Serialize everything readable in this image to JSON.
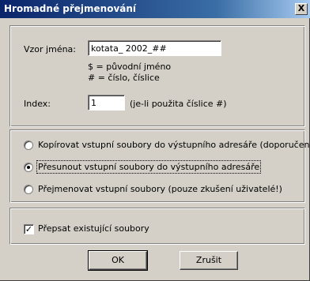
{
  "window": {
    "title": "Hromadné přejmenování",
    "close_glyph": "X"
  },
  "pattern": {
    "label": "Vzor jména:",
    "value": "kotata_ 2002_##",
    "hint_line1": "$ = původní jméno",
    "hint_line2": "# = číslo, číslice"
  },
  "index": {
    "label": "Index:",
    "value": "1",
    "note": "(je-li použita číslice #)"
  },
  "options": [
    {
      "label": "Kopírovat vstupní soubory do výstupního adresáře (doporučeno)",
      "selected": false
    },
    {
      "label": "Přesunout vstupní soubory do výstupního adresáře",
      "selected": true
    },
    {
      "label": "Přejmenovat vstupní soubory (pouze zkušení uživatelé!)",
      "selected": false
    }
  ],
  "overwrite": {
    "label": "Přepsat existující soubory",
    "checked": true
  },
  "buttons": {
    "ok": "OK",
    "cancel": "Zrušit"
  },
  "colors": {
    "titlebar_start": "#0a246a",
    "titlebar_end": "#a6caf0",
    "dialog_face": "#d4d0c8"
  }
}
